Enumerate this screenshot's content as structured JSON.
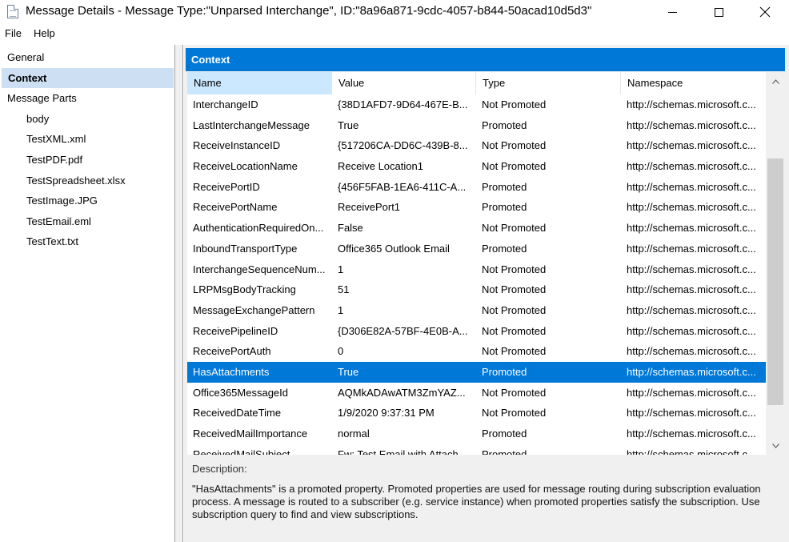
{
  "window": {
    "title": "Message Details - Message Type:\"Unparsed Interchange\", ID:\"8a96a871-9cdc-4057-b844-50acad10d5d3\""
  },
  "menu": [
    "File",
    "Help"
  ],
  "sidebar": {
    "items": [
      {
        "label": "General"
      },
      {
        "label": "Context",
        "selected": true
      },
      {
        "label": "Message Parts"
      }
    ],
    "parts": [
      "body",
      "TestXML.xml",
      "TestPDF.pdf",
      "TestSpreadsheet.xlsx",
      "TestImage.JPG",
      "TestEmail.eml",
      "TestText.txt"
    ]
  },
  "pane": {
    "header": "Context",
    "columns": [
      "Name",
      "Value",
      "Type",
      "Namespace"
    ],
    "rows": [
      [
        "InterchangeID",
        "{38D1AFD7-9D64-467E-B...",
        "Not Promoted",
        "http://schemas.microsoft.c..."
      ],
      [
        "LastInterchangeMessage",
        "True",
        "Promoted",
        "http://schemas.microsoft.c..."
      ],
      [
        "ReceiveInstanceID",
        "{517206CA-DD6C-439B-8...",
        "Not Promoted",
        "http://schemas.microsoft.c..."
      ],
      [
        "ReceiveLocationName",
        "Receive Location1",
        "Not Promoted",
        "http://schemas.microsoft.c..."
      ],
      [
        "ReceivePortID",
        "{456F5FAB-1EA6-411C-A...",
        "Promoted",
        "http://schemas.microsoft.c..."
      ],
      [
        "ReceivePortName",
        "ReceivePort1",
        "Promoted",
        "http://schemas.microsoft.c..."
      ],
      [
        "AuthenticationRequiredOn...",
        "False",
        "Not Promoted",
        "http://schemas.microsoft.c..."
      ],
      [
        "InboundTransportType",
        "Office365 Outlook Email",
        "Promoted",
        "http://schemas.microsoft.c..."
      ],
      [
        "InterchangeSequenceNum...",
        "1",
        "Not Promoted",
        "http://schemas.microsoft.c..."
      ],
      [
        "LRPMsgBodyTracking",
        "51",
        "Not Promoted",
        "http://schemas.microsoft.c..."
      ],
      [
        "MessageExchangePattern",
        "1",
        "Not Promoted",
        "http://schemas.microsoft.c..."
      ],
      [
        "ReceivePipelineID",
        "{D306E82A-57BF-4E0B-A...",
        "Not Promoted",
        "http://schemas.microsoft.c..."
      ],
      [
        "ReceivePortAuth",
        "0",
        "Not Promoted",
        "http://schemas.microsoft.c..."
      ],
      [
        "HasAttachments",
        "True",
        "Promoted",
        "http://schemas.microsoft.c..."
      ],
      [
        "Office365MessageId",
        "AQMkADAwATM3ZmYAZ...",
        "Not Promoted",
        "http://schemas.microsoft.c..."
      ],
      [
        "ReceivedDateTime",
        "1/9/2020 9:37:31 PM",
        "Not Promoted",
        "http://schemas.microsoft.c..."
      ],
      [
        "ReceivedMailImportance",
        "normal",
        "Promoted",
        "http://schemas.microsoft.c..."
      ],
      [
        "ReceivedMailSubject",
        "Fw: Test Email with Attach...",
        "Promoted",
        "http://schemas.microsoft.c..."
      ]
    ],
    "selected_row": "HasAttachments",
    "description_label": "Description:",
    "description": "\"HasAttachments\" is a promoted property. Promoted properties are used for message routing during subscription evaluation process. A message is routed to a subscriber (e.g. service instance) when promoted properties satisfy the subscription. Use subscription query to find and view subscriptions."
  },
  "colors": {
    "accent": "#0078d7",
    "nav_selected": "#cde0f3",
    "sorted_header": "#cce8ff"
  }
}
